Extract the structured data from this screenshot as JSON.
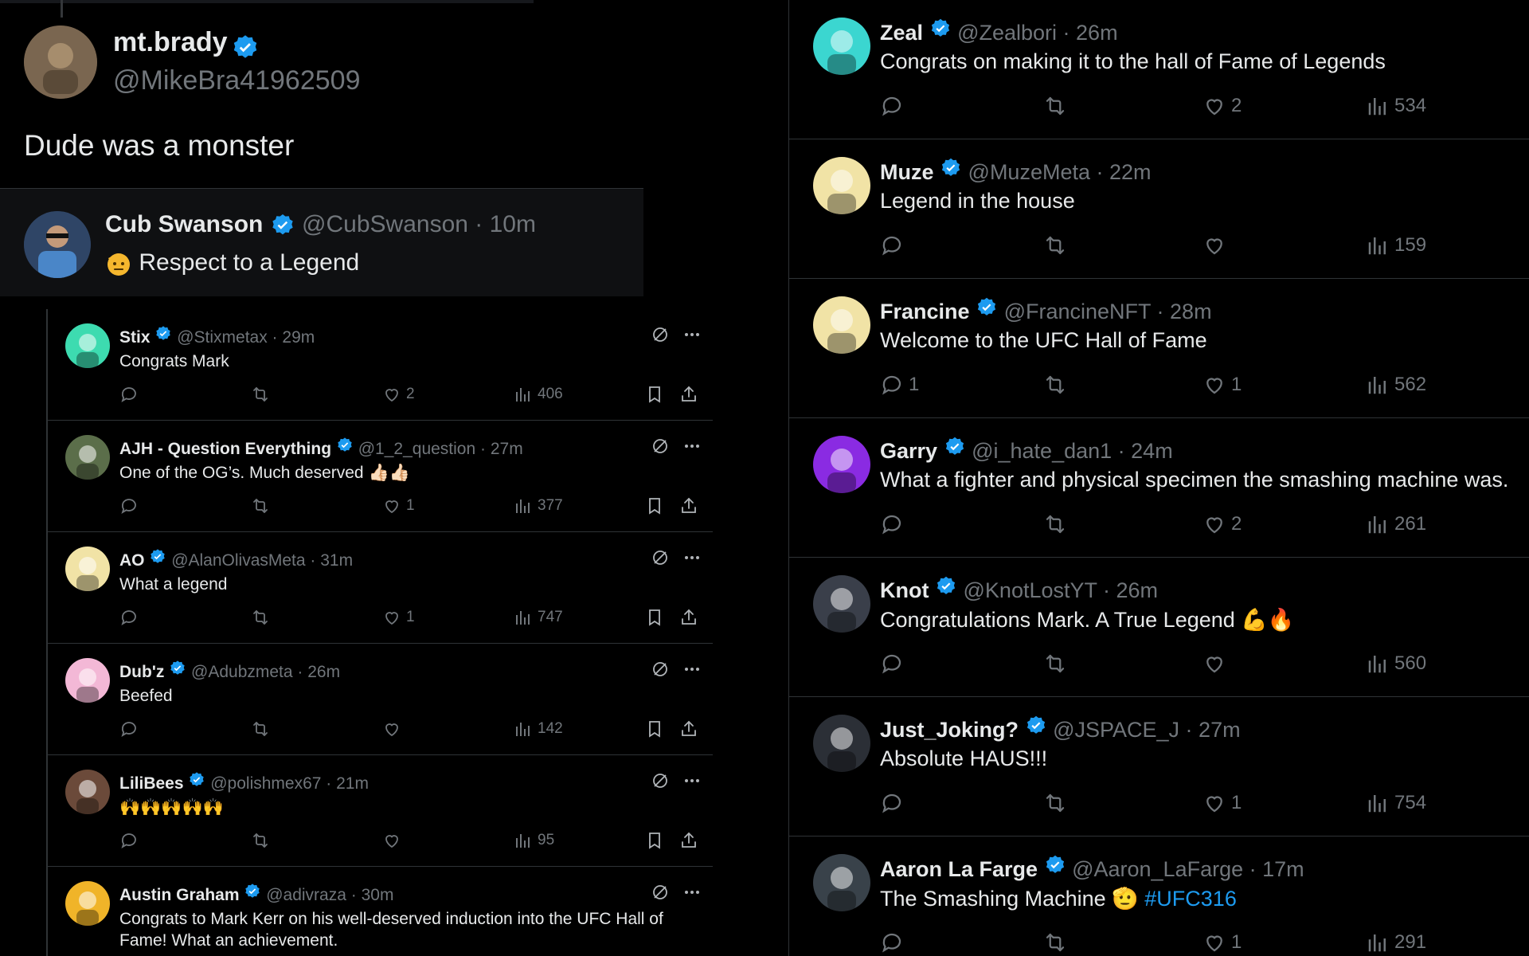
{
  "top_tweet": {
    "name": "mt.brady",
    "handle": "@MikeBra41962509",
    "text": "Dude was a monster"
  },
  "quoted": {
    "name": "Cub Swanson",
    "handle": "@CubSwanson",
    "time": "10m",
    "text": "Respect to a Legend"
  },
  "left_replies": [
    {
      "name": "Stix",
      "handle": "@Stixmetax",
      "time": "29m",
      "text": "Congrats Mark",
      "likes": "2",
      "views": "406",
      "avatar_color": "#3ddbb0"
    },
    {
      "name": "AJH - Question Everything",
      "handle": "@1_2_question",
      "time": "27m",
      "text": "One of the OG’s. Much deserved",
      "likes": "1",
      "views": "377",
      "avatar_color": "#5b6e4a"
    },
    {
      "name": "AO",
      "handle": "@AlanOlivasMeta",
      "time": "31m",
      "text": "What a legend",
      "likes": "1",
      "views": "747",
      "avatar_color": "#f1e3a6"
    },
    {
      "name": "Dub'z",
      "handle": "@Adubzmeta",
      "time": "26m",
      "text": "Beefed",
      "likes": "",
      "views": "142",
      "avatar_color": "#f3b8d6"
    },
    {
      "name": "LiliBees",
      "handle": "@polishmex67",
      "time": "21m",
      "text": "🙌🙌🙌🙌🙌",
      "likes": "",
      "views": "95",
      "avatar_color": "#6b4a3a"
    },
    {
      "name": "Austin Graham",
      "handle": "@adivraza",
      "time": "30m",
      "text": "Congrats to Mark Kerr on his well-deserved induction into the UFC Hall of Fame! What an achievement.",
      "likes": "",
      "views": "",
      "avatar_color": "#f0b429"
    }
  ],
  "right_replies": [
    {
      "name": "Zeal",
      "handle": "@Zealbori",
      "time": "26m",
      "text": "Congrats on making it to the hall of Fame of Legends",
      "replies": "",
      "likes": "2",
      "views": "534",
      "avatar_color": "#3bd6d0"
    },
    {
      "name": "Muze",
      "handle": "@MuzeMeta",
      "time": "22m",
      "text": "Legend in the house",
      "replies": "",
      "likes": "",
      "views": "159",
      "avatar_color": "#f1e3a6"
    },
    {
      "name": "Francine",
      "handle": "@FrancineNFT",
      "time": "28m",
      "text": "Welcome to the UFC Hall of Fame",
      "replies": "1",
      "likes": "1",
      "views": "562",
      "avatar_color": "#f1e3a6"
    },
    {
      "name": "Garry",
      "handle": "@i_hate_dan1",
      "time": "24m",
      "text": "What a fighter and physical specimen the smashing machine was.",
      "replies": "",
      "likes": "2",
      "views": "261",
      "avatar_color": "#8a2be2"
    },
    {
      "name": "Knot",
      "handle": "@KnotLostYT",
      "time": "26m",
      "text": "Congratulations Mark. A True Legend 💪🔥",
      "replies": "",
      "likes": "",
      "views": "560",
      "avatar_color": "#3a3f4a"
    },
    {
      "name": "Just_Joking?",
      "handle": "@JSPACE_J",
      "time": "27m",
      "text": "Absolute HAUS!!!",
      "replies": "",
      "likes": "1",
      "views": "754",
      "avatar_color": "#2b2f36"
    },
    {
      "name": "Aaron La Farge",
      "handle": "@Aaron_LaFarge",
      "time": "17m",
      "text": "The Smashing Machine",
      "hashtag": "#UFC316",
      "replies": "",
      "likes": "1",
      "views": "291",
      "avatar_color": "#39424a"
    }
  ],
  "colors": {
    "background": "#000000",
    "text": "#e7e9ea",
    "muted": "#71767b",
    "verified": "#1d9bf0",
    "divider": "#2f3336"
  },
  "icons": [
    "verified-badge-icon",
    "reply-icon",
    "retweet-icon",
    "like-icon",
    "views-icon",
    "bookmark-icon",
    "share-icon",
    "grok-icon",
    "more-icon"
  ]
}
